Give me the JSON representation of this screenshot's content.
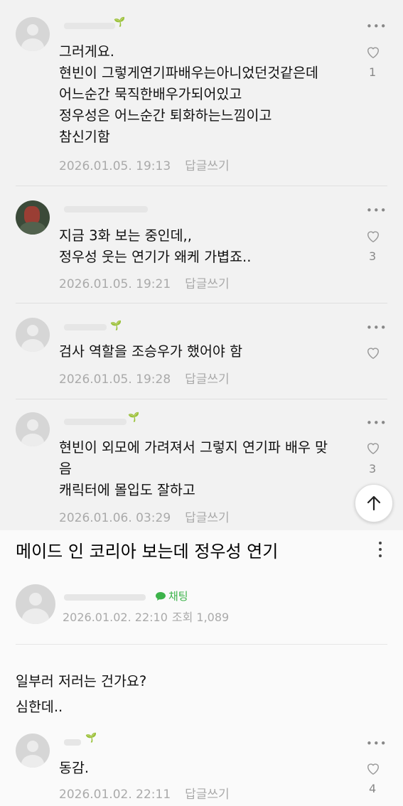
{
  "comments": [
    {
      "text": "그러게요.\n현빈이 그렇게연기파배우는아니었던것같은데\n어느순간 묵직한배우가되어있고\n정우성은 어느순간 퇴화하는느낌이고\n참신기함",
      "date": "2026.01.05. 19:13",
      "reply_label": "답글쓰기",
      "likes": "1"
    },
    {
      "text": "지금 3화 보는 중인데,,\n정우성 웃는 연기가 왜케 가볍죠..",
      "date": "2026.01.05. 19:21",
      "reply_label": "답글쓰기",
      "likes": "3"
    },
    {
      "text": "검사 역할을 조승우가 했어야 함",
      "date": "2026.01.05. 19:28",
      "reply_label": "답글쓰기",
      "likes": ""
    },
    {
      "text": "현빈이 외모에 가려져서 그렇지 연기파 배우 맞\n음\n캐릭터에 몰입도 잘하고",
      "date": "2026.01.06. 03:29",
      "reply_label": "답글쓰기",
      "likes": "3"
    }
  ],
  "post": {
    "title": "메이드 인 코리아 보는데 정우성 연기",
    "chat_label": "채팅",
    "date": "2026.01.02. 22:10",
    "views": "조회 1,089",
    "body": "일부러 저러는 건가요?\n심한데.."
  },
  "post_comment": {
    "text": "동감.",
    "date": "2026.01.02. 22:11",
    "reply_label": "답글쓰기",
    "likes": "4"
  },
  "icons": {
    "more": "more-dots-icon",
    "like": "heart-outline-icon",
    "scroll_top": "arrow-up-icon",
    "chat": "chat-bubble-icon",
    "sprout": "sprout-icon"
  },
  "colors": {
    "chat_green": "#3cb34a",
    "sprout_green": "#52c41a",
    "meta_gray": "#aaaaaa"
  }
}
